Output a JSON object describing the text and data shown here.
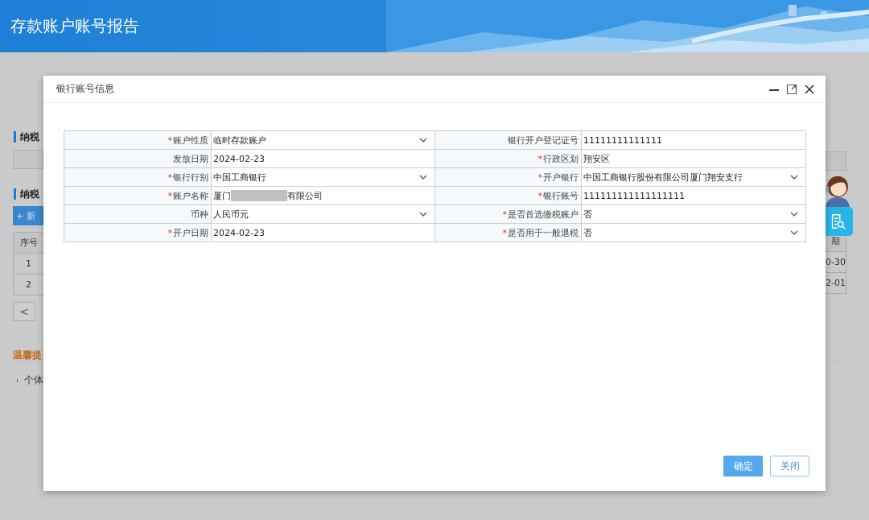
{
  "header": {
    "title": "存款账户账号报告"
  },
  "page": {
    "left": {
      "section_1": "纳税",
      "section_2": "纳税",
      "add_button": "+ 新",
      "table_header": "序号",
      "rows": [
        "1",
        "2"
      ],
      "pager": "<",
      "tip_title": "温馨提",
      "tip_item": "个体"
    },
    "right": {
      "table_header": "期",
      "rows": [
        "0-30",
        "2-01"
      ]
    }
  },
  "dialog": {
    "title": "银行账号信息",
    "fields": [
      {
        "label": "账户性质",
        "required_mark": "*",
        "kind": "select",
        "value": "临时存款账户"
      },
      {
        "label": "银行开户登记证号",
        "kind": "text",
        "value": "11111111111111"
      },
      {
        "label": "发放日期",
        "kind": "text",
        "value": "2024-02-23"
      },
      {
        "label": "行政区划",
        "required_mark": "*",
        "kind": "text",
        "value": "翔安区"
      },
      {
        "label": "银行行别",
        "required_mark": "*",
        "kind": "select",
        "value": "中国工商银行"
      },
      {
        "label": "开户银行",
        "required_mark": "*",
        "kind": "select",
        "value": "中国工商银行股份有限公司厦门翔安支行"
      },
      {
        "label": "账户名称",
        "required_mark": "*",
        "kind": "redacted",
        "value": "厦门",
        "value_end": "有限公司"
      },
      {
        "label": "银行账号",
        "required_mark": "*",
        "kind": "text",
        "value": "111111111111111111"
      },
      {
        "label": "币种",
        "kind": "select",
        "value": "人民币元"
      },
      {
        "label": "是否首选缴税账户",
        "required_mark": "*",
        "kind": "select",
        "value": "否"
      },
      {
        "label": "开户日期",
        "required_mark": "*",
        "kind": "text",
        "value": "2024-02-23"
      },
      {
        "label": "是否用于一般退税",
        "required_mark": "*",
        "kind": "select",
        "value": "否"
      }
    ],
    "buttons": [
      {
        "label": "确定",
        "kind": "primary"
      },
      {
        "label": "关闭",
        "kind": "secondary"
      }
    ]
  }
}
